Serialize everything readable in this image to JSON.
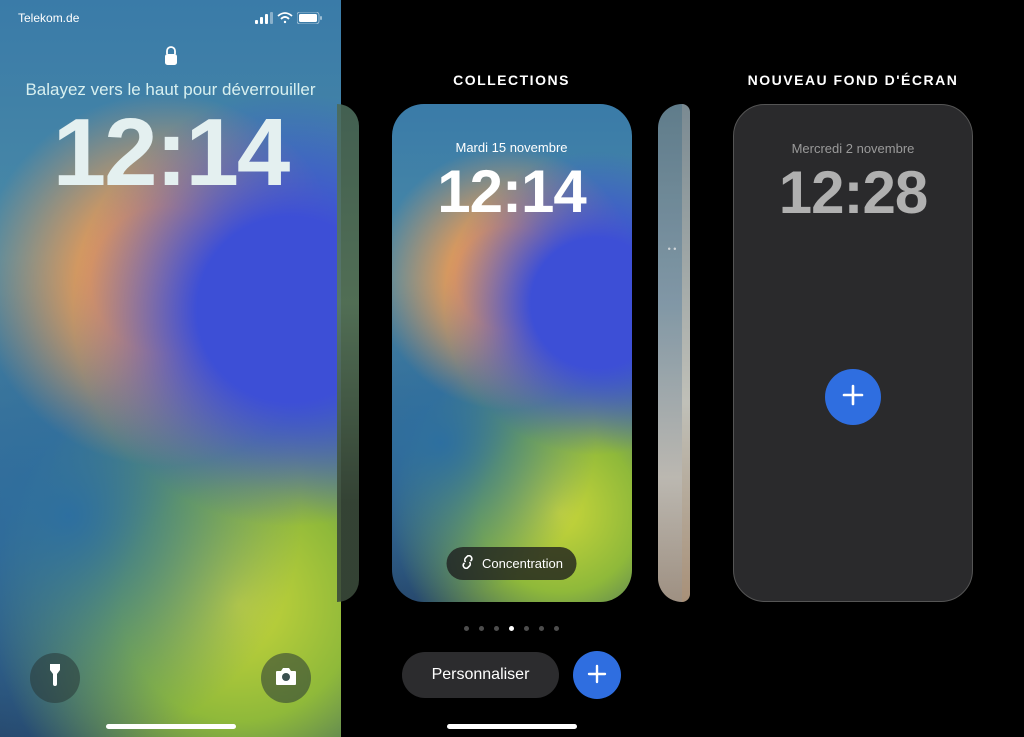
{
  "panel1": {
    "carrier": "Telekom.de",
    "swipe_hint": "Balayez vers le haut pour déverrouiller",
    "time": "12:14"
  },
  "panel2": {
    "title": "COLLECTIONS",
    "preview_date": "Mardi 15 novembre",
    "preview_time": "12:14",
    "concentration_label": "Concentration",
    "personalize_label": "Personnaliser",
    "page_count": 7,
    "active_page_index": 3
  },
  "panel3": {
    "title": "NOUVEAU FOND D'ÉCRAN",
    "preview_date": "Mercredi 2 novembre",
    "preview_time": "12:28"
  },
  "icons": {
    "lock": "lock-icon",
    "flashlight": "flashlight-icon",
    "camera": "camera-icon",
    "link": "link-icon",
    "plus": "plus-icon",
    "signal": "signal-icon",
    "wifi": "wifi-icon",
    "battery": "battery-icon"
  },
  "colors": {
    "accent_blue": "#2f6ee0",
    "dark_pill": "#2c2c2e"
  }
}
